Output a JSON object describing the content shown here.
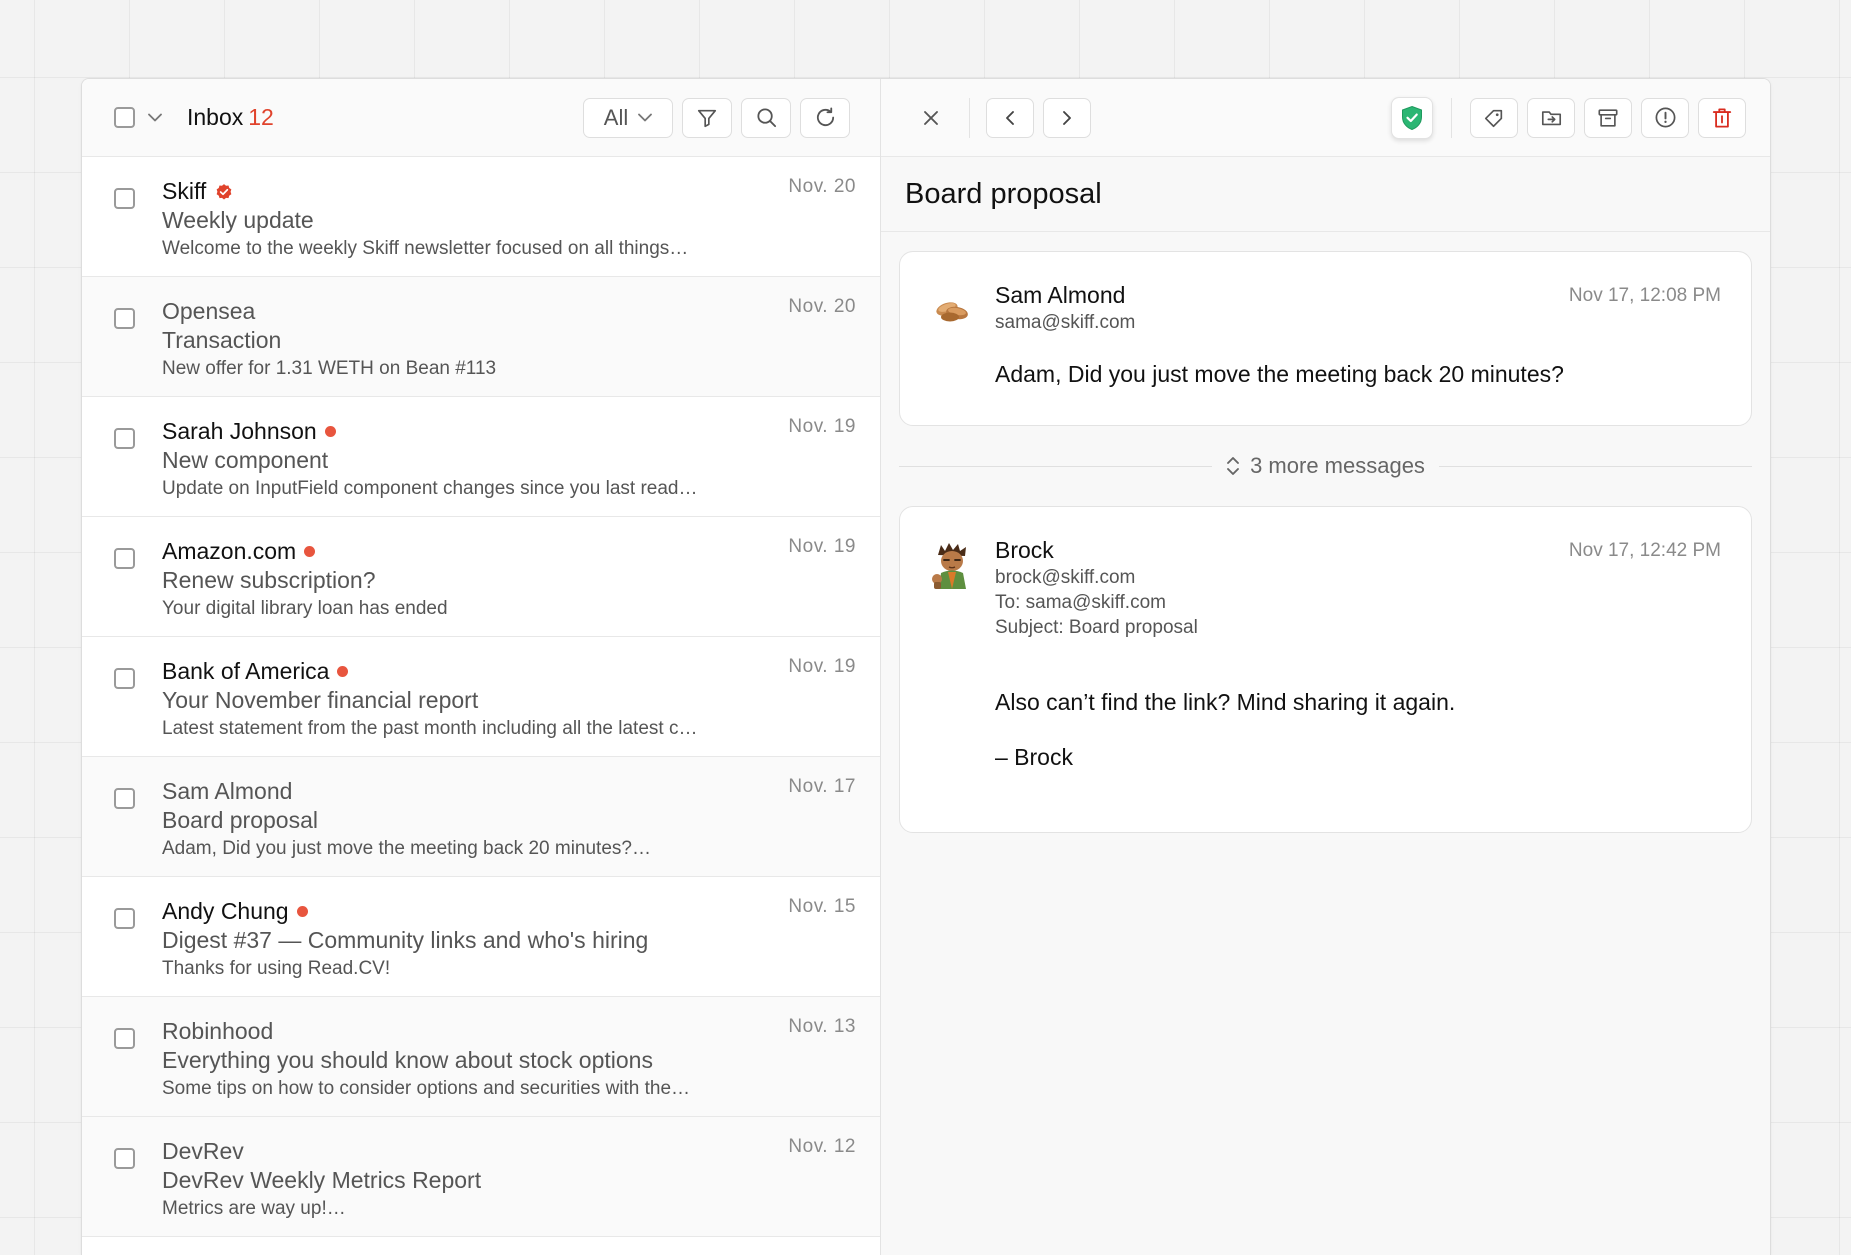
{
  "list_header": {
    "title": "Inbox",
    "count": "12",
    "filter_value": "All"
  },
  "emails": [
    {
      "sender": "Skiff",
      "subject": "Weekly update",
      "preview": "Welcome to the weekly Skiff newsletter focused on all things…",
      "date": "Nov. 20",
      "unread": true,
      "verified": true,
      "dot": false
    },
    {
      "sender": "Opensea",
      "subject": "Transaction",
      "preview": "New offer for 1.31 WETH on Bean #113",
      "date": "Nov. 20",
      "unread": false,
      "verified": false,
      "dot": false
    },
    {
      "sender": "Sarah Johnson",
      "subject": "New component",
      "preview": "Update on InputField component changes since you  last read…",
      "date": "Nov. 19",
      "unread": true,
      "verified": false,
      "dot": true
    },
    {
      "sender": "Amazon.com",
      "subject": "Renew subscription?",
      "preview": "Your digital library loan has ended",
      "date": "Nov. 19",
      "unread": true,
      "verified": false,
      "dot": true
    },
    {
      "sender": "Bank of America",
      "subject": "Your November financial report",
      "preview": "Latest statement from the past month including all the latest c…",
      "date": "Nov. 19",
      "unread": true,
      "verified": false,
      "dot": true
    },
    {
      "sender": "Sam Almond",
      "subject": "Board proposal",
      "preview": "Adam, Did you just move the meeting back 20 minutes?…",
      "date": "Nov. 17",
      "unread": false,
      "verified": false,
      "dot": false
    },
    {
      "sender": "Andy Chung",
      "subject": "Digest #37 — Community links and who's hiring",
      "preview": "Thanks for using Read.CV!",
      "date": "Nov. 15",
      "unread": true,
      "verified": false,
      "dot": true
    },
    {
      "sender": "Robinhood",
      "subject": "Everything you should know about stock options",
      "preview": "Some tips on how to consider options and securities with the…",
      "date": "Nov. 13",
      "unread": false,
      "verified": false,
      "dot": false
    },
    {
      "sender": "DevRev",
      "subject": "DevRev Weekly Metrics Report",
      "preview": "Metrics are way up!…",
      "date": "Nov. 12",
      "unread": false,
      "verified": false,
      "dot": false
    }
  ],
  "reader": {
    "thread_title": "Board proposal",
    "more_messages": "3 more messages",
    "messages": [
      {
        "name": "Sam Almond",
        "email": "sama@skiff.com",
        "time": "Nov 17, 12:08 PM",
        "body": "Adam, Did you just move the meeting back 20 minutes?"
      },
      {
        "name": "Brock",
        "email": "brock@skiff.com",
        "to": "To: sama@skiff.com",
        "subject": "Subject: Board proposal",
        "time": "Nov 17, 12:42 PM",
        "body": "Also can’t find the link? Mind sharing it again.",
        "signature": "– Brock"
      }
    ]
  },
  "icons": {
    "caret": "chevron-down-icon",
    "filter": "funnel-icon",
    "search": "search-icon",
    "refresh": "refresh-icon",
    "close": "close-icon",
    "prev": "chevron-left-icon",
    "next": "chevron-right-icon",
    "shield": "shield-check-icon",
    "tag": "tag-icon",
    "move": "folder-move-icon",
    "archive": "archive-icon",
    "spam": "alert-circle-icon",
    "trash": "trash-icon",
    "expand": "expand-vertical-icon",
    "verified": "verified-badge-icon"
  },
  "colors": {
    "accent": "#e0432c",
    "unread_dot": "#e8553e",
    "shield_green": "#2bb673",
    "trash_red": "#d92d20"
  }
}
